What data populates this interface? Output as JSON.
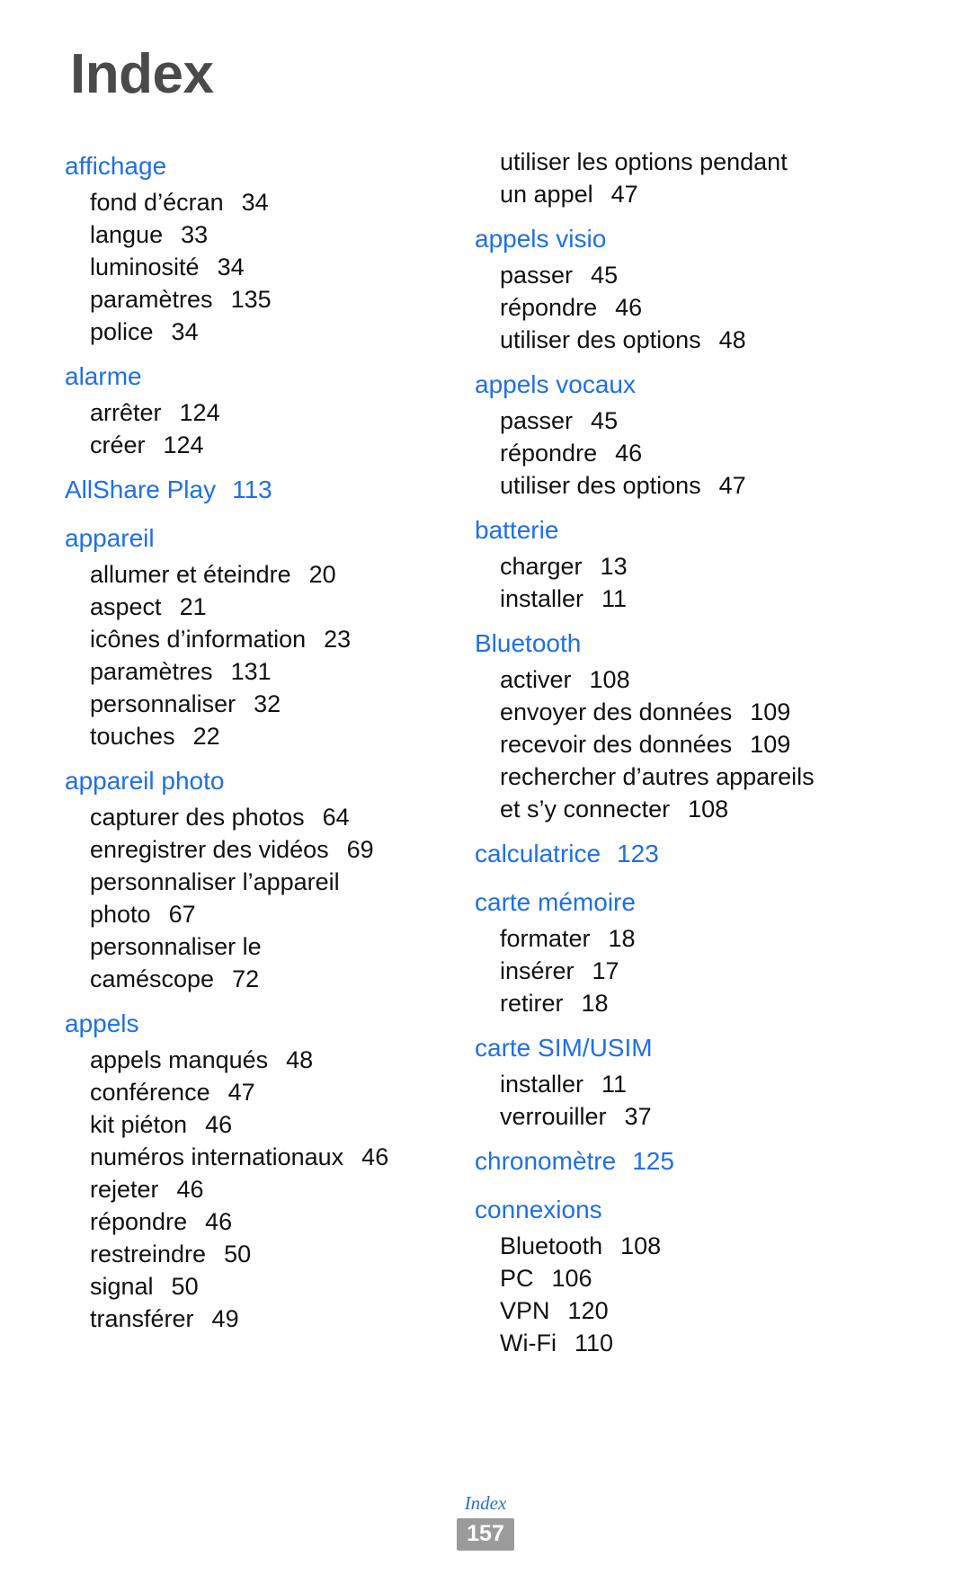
{
  "page": {
    "title": "Index",
    "accent_color": "#1f6fe8",
    "title_color": "#4a4a4a",
    "body_color": "#111111"
  },
  "footer": {
    "label": "Index",
    "page_number": "157",
    "badge_color": "#9b9b9b"
  },
  "columns": [
    {
      "entries": [
        {
          "heading": "affichage",
          "heading_page": "",
          "subs": [
            {
              "label": "fond d’écran",
              "page": "34"
            },
            {
              "label": "langue",
              "page": "33"
            },
            {
              "label": "luminosité",
              "page": "34"
            },
            {
              "label": "paramètres",
              "page": "135"
            },
            {
              "label": "police",
              "page": "34"
            }
          ]
        },
        {
          "heading": "alarme",
          "heading_page": "",
          "subs": [
            {
              "label": "arrêter",
              "page": "124"
            },
            {
              "label": "créer",
              "page": "124"
            }
          ]
        },
        {
          "heading": "AllShare Play",
          "heading_page": "113",
          "subs": []
        },
        {
          "heading": "appareil",
          "heading_page": "",
          "subs": [
            {
              "label": "allumer et éteindre",
              "page": "20"
            },
            {
              "label": "aspect",
              "page": "21"
            },
            {
              "label": "icônes d’information",
              "page": "23"
            },
            {
              "label": "paramètres",
              "page": "131"
            },
            {
              "label": "personnaliser",
              "page": "32"
            },
            {
              "label": "touches",
              "page": "22"
            }
          ]
        },
        {
          "heading": "appareil photo",
          "heading_page": "",
          "subs": [
            {
              "label": "capturer des photos",
              "page": "64"
            },
            {
              "label": "enregistrer des vidéos",
              "page": "69"
            },
            {
              "label": "personnaliser l’appareil",
              "label2": "photo",
              "page": "67"
            },
            {
              "label": "personnaliser le",
              "label2": "caméscope",
              "page": "72"
            }
          ]
        },
        {
          "heading": "appels",
          "heading_page": "",
          "subs": [
            {
              "label": "appels manqués",
              "page": "48"
            },
            {
              "label": "conférence",
              "page": "47"
            },
            {
              "label": "kit piéton",
              "page": "46"
            },
            {
              "label": "numéros internationaux",
              "page": "46"
            },
            {
              "label": "rejeter",
              "page": "46"
            },
            {
              "label": "répondre",
              "page": "46"
            },
            {
              "label": "restreindre",
              "page": "50"
            },
            {
              "label": "signal",
              "page": "50"
            },
            {
              "label": "transférer",
              "page": "49"
            }
          ]
        }
      ]
    },
    {
      "entries": [
        {
          "heading": "",
          "heading_page": "",
          "subs": [
            {
              "label": "utiliser les options pendant",
              "label2": "un appel",
              "page": "47"
            }
          ]
        },
        {
          "heading": "appels visio",
          "heading_page": "",
          "subs": [
            {
              "label": "passer",
              "page": "45"
            },
            {
              "label": "répondre",
              "page": "46"
            },
            {
              "label": "utiliser des options",
              "page": "48"
            }
          ]
        },
        {
          "heading": "appels vocaux",
          "heading_page": "",
          "subs": [
            {
              "label": "passer",
              "page": "45"
            },
            {
              "label": "répondre",
              "page": "46"
            },
            {
              "label": "utiliser des options",
              "page": "47"
            }
          ]
        },
        {
          "heading": "batterie",
          "heading_page": "",
          "subs": [
            {
              "label": "charger",
              "page": "13"
            },
            {
              "label": "installer",
              "page": "11"
            }
          ]
        },
        {
          "heading": "Bluetooth",
          "heading_page": "",
          "subs": [
            {
              "label": "activer",
              "page": "108"
            },
            {
              "label": "envoyer des données",
              "page": "109"
            },
            {
              "label": "recevoir des données",
              "page": "109"
            },
            {
              "label": "rechercher d’autres appareils",
              "label2": "et s’y connecter",
              "page": "108"
            }
          ]
        },
        {
          "heading": "calculatrice",
          "heading_page": "123",
          "subs": []
        },
        {
          "heading": "carte mémoire",
          "heading_page": "",
          "subs": [
            {
              "label": "formater",
              "page": "18"
            },
            {
              "label": "insérer",
              "page": "17"
            },
            {
              "label": "retirer",
              "page": "18"
            }
          ]
        },
        {
          "heading": "carte SIM/USIM",
          "heading_page": "",
          "subs": [
            {
              "label": "installer",
              "page": "11"
            },
            {
              "label": "verrouiller",
              "page": "37"
            }
          ]
        },
        {
          "heading": "chronomètre",
          "heading_page": "125",
          "subs": []
        },
        {
          "heading": "connexions",
          "heading_page": "",
          "subs": [
            {
              "label": "Bluetooth",
              "page": "108"
            },
            {
              "label": "PC",
              "page": "106"
            },
            {
              "label": "VPN",
              "page": "120"
            },
            {
              "label": "Wi-Fi",
              "page": "110"
            }
          ]
        }
      ]
    }
  ]
}
